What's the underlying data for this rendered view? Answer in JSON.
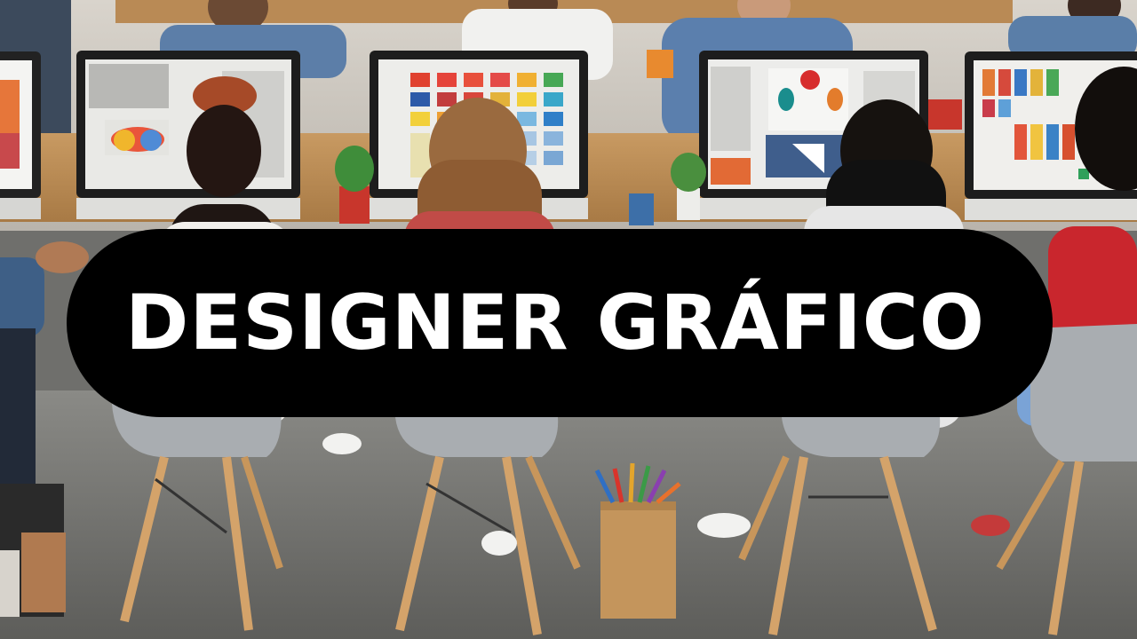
{
  "banner": {
    "title": "DESIGNER GRÁFICO"
  },
  "colors": {
    "pill_background": "#000000",
    "title_text": "#ffffff"
  }
}
